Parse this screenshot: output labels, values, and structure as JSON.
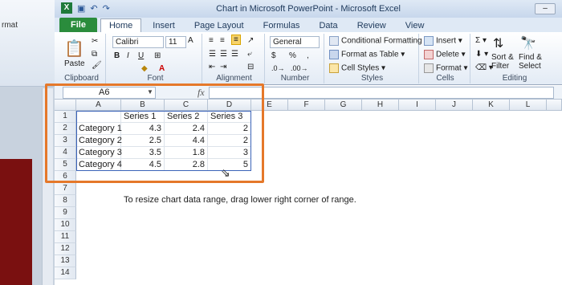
{
  "ppt": {
    "label": "rmat"
  },
  "window": {
    "title": "Chart in Microsoft PowerPoint  -  Microsoft Excel"
  },
  "tabs": [
    "File",
    "Home",
    "Insert",
    "Page Layout",
    "Formulas",
    "Data",
    "Review",
    "View"
  ],
  "ribbon": {
    "clipboard": {
      "paste": "Paste",
      "label": "Clipboard"
    },
    "font": {
      "name": "Calibri",
      "size": "11",
      "label": "Font"
    },
    "alignment": {
      "label": "Alignment"
    },
    "number": {
      "format": "General",
      "label": "Number"
    },
    "styles": {
      "cond": "Conditional Formatting",
      "table": "Format as Table",
      "cell": "Cell Styles",
      "label": "Styles"
    },
    "cells": {
      "insert": "Insert",
      "delete": "Delete",
      "format": "Format",
      "label": "Cells"
    },
    "editing": {
      "sort": "Sort &",
      "sort2": "Filter",
      "find": "Find &",
      "find2": "Select",
      "label": "Editing"
    }
  },
  "formula_bar": {
    "name_box": "A6",
    "fx": "fx"
  },
  "columns": [
    "A",
    "B",
    "C",
    "D",
    "E",
    "F",
    "G",
    "H",
    "I",
    "J",
    "K",
    "L"
  ],
  "rows": [
    "1",
    "2",
    "3",
    "4",
    "5",
    "6",
    "7",
    "8",
    "9",
    "10",
    "11",
    "12",
    "13",
    "14"
  ],
  "table": {
    "headers": [
      "",
      "Series 1",
      "Series 2",
      "Series 3"
    ],
    "data": [
      [
        "Category 1",
        "4.3",
        "2.4",
        "2"
      ],
      [
        "Category 2",
        "2.5",
        "4.4",
        "2"
      ],
      [
        "Category 3",
        "3.5",
        "1.8",
        "3"
      ],
      [
        "Category 4",
        "4.5",
        "2.8",
        "5"
      ]
    ]
  },
  "note": "To resize chart data range, drag lower right corner of range."
}
